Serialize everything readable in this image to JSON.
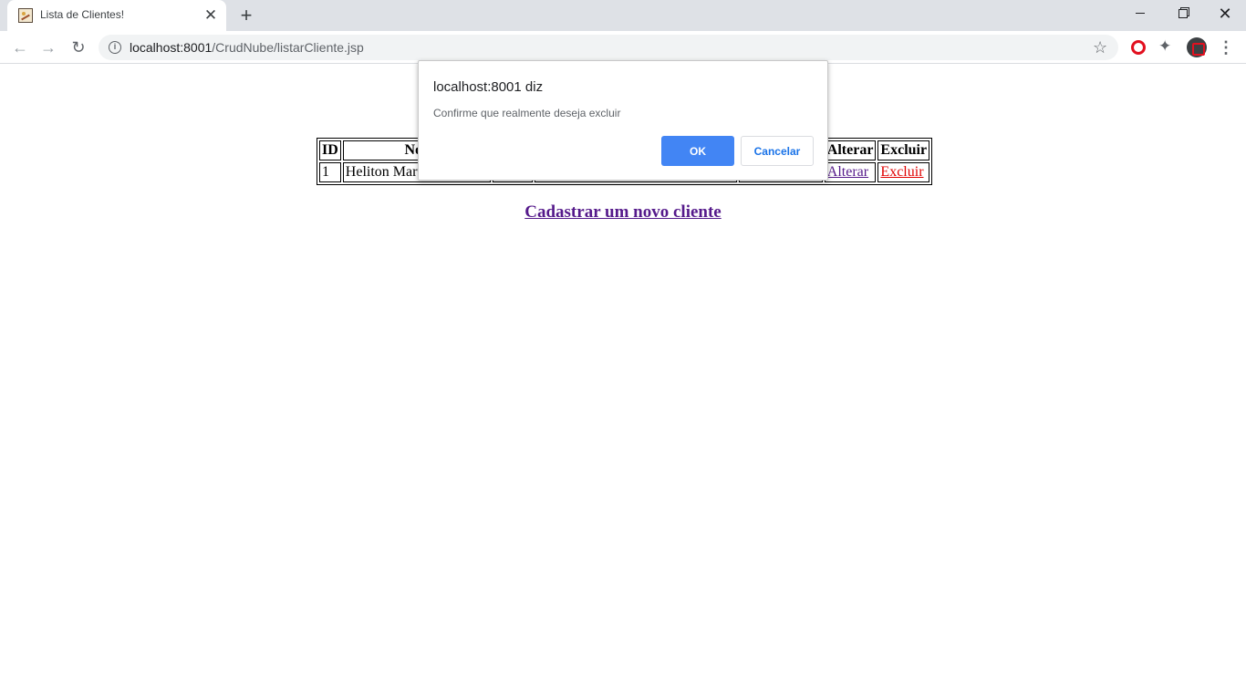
{
  "browser": {
    "tab_title": "Lista de Clientes!",
    "tab_close": "✕",
    "new_tab": "+",
    "window_close": "✕",
    "back_icon": "←",
    "forward_icon": "→",
    "reload_icon": "↻",
    "url_host": "localhost:8001",
    "url_path": "/CrudNube/listarCliente.jsp",
    "star_icon": "☆",
    "menu_icon": "⋮"
  },
  "table": {
    "headers": {
      "id": "ID",
      "nome_visible": "Nor",
      "alterar": "Alterar",
      "excluir": "Excluir"
    },
    "rows": [
      {
        "id": "1",
        "nome_visible": "Heliton Mart",
        "alterar": "Alterar",
        "excluir": "Excluir"
      }
    ]
  },
  "links": {
    "new_client": "Cadastrar um novo cliente"
  },
  "dialog": {
    "title": "localhost:8001 diz",
    "message": "Confirme que realmente deseja excluir",
    "ok_label": "OK",
    "cancel_label": "Cancelar"
  },
  "colors": {
    "tabstrip": "#dee1e6",
    "ok_button": "#4285f4",
    "visited_link": "#551a8b",
    "delete_link": "#e00000"
  }
}
